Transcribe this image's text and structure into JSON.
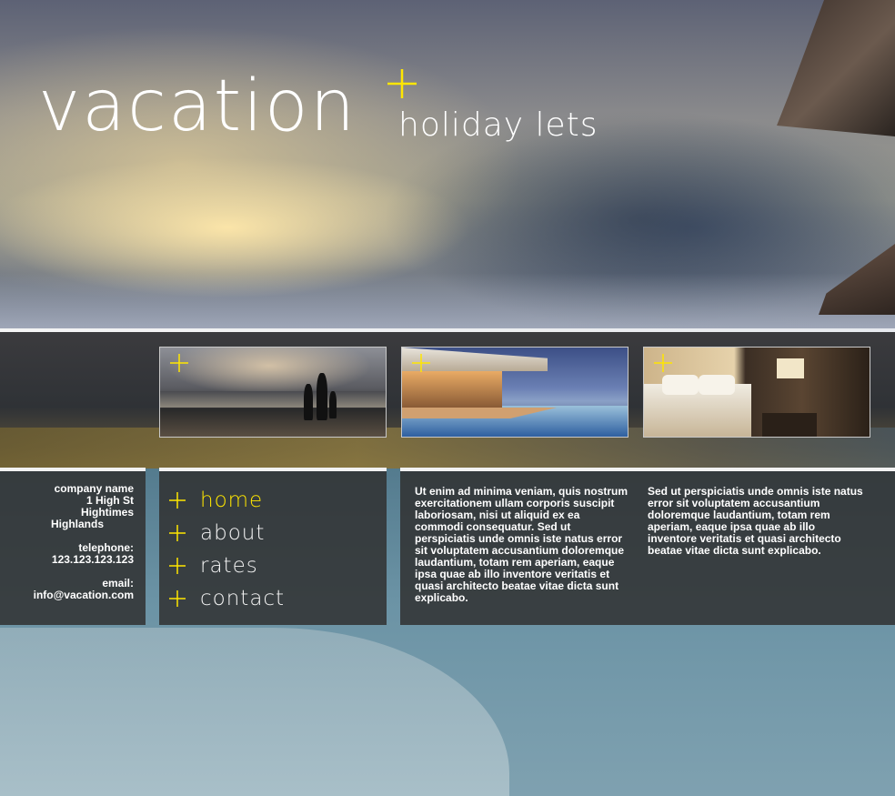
{
  "site": {
    "logo_text": "vacation",
    "tagline": "holiday lets",
    "accent_color": "#ffe600"
  },
  "gallery": {
    "items": [
      {
        "name": "beach-family-photo",
        "icon": "plus-icon"
      },
      {
        "name": "poolside-villa-photo",
        "icon": "plus-icon"
      },
      {
        "name": "bedroom-photo",
        "icon": "plus-icon"
      }
    ]
  },
  "contact": {
    "company": "company name",
    "address1": "1 High St",
    "address2": "Hightimes",
    "address3": "Highlands",
    "telephone_label": "telephone:",
    "telephone": "123.123.123.123",
    "email_label": "email:",
    "email": "info@vacation.com"
  },
  "nav": {
    "items": [
      {
        "label": "home",
        "active": true
      },
      {
        "label": "about",
        "active": false
      },
      {
        "label": "rates",
        "active": false
      },
      {
        "label": "contact",
        "active": false
      }
    ]
  },
  "content": {
    "col1": "Ut enim ad minima veniam, quis nostrum exercitationem ullam corporis suscipit laboriosam, nisi ut aliquid ex ea commodi consequatur. Sed ut perspiciatis unde omnis iste natus error sit voluptatem accusantium doloremque laudantium, totam rem aperiam, eaque ipsa quae ab illo inventore veritatis et quasi architecto beatae vitae dicta sunt explicabo.",
    "col2": "Sed ut perspiciatis unde omnis iste natus error sit voluptatem accusantium doloremque laudantium, totam rem aperiam, eaque ipsa quae ab illo inventore veritatis et quasi architecto beatae vitae dicta sunt explicabo."
  }
}
